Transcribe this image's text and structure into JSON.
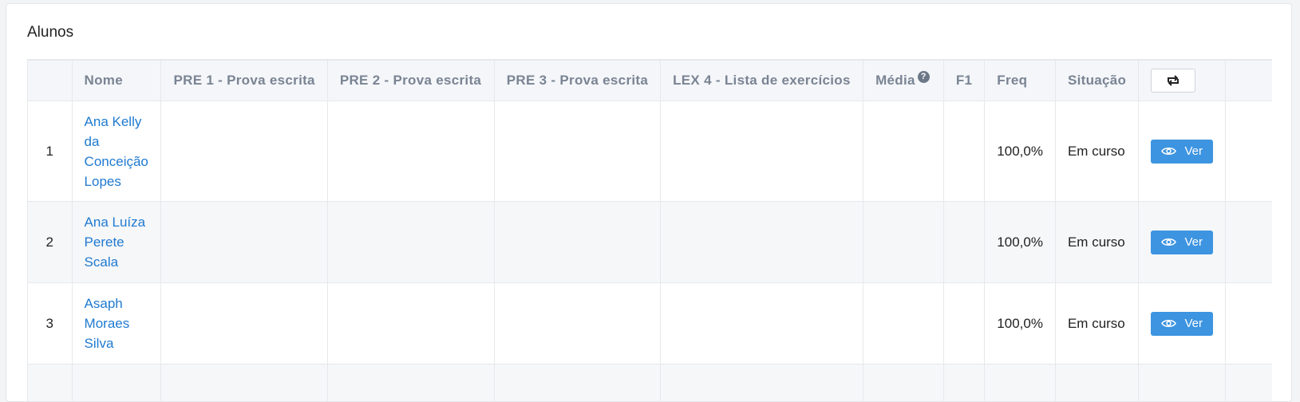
{
  "card": {
    "title": "Alunos"
  },
  "table": {
    "headers": {
      "index": "",
      "nome": "Nome",
      "pre1": "PRE 1 - Prova escrita",
      "pre2": "PRE 2 - Prova escrita",
      "pre3": "PRE 3 - Prova escrita",
      "lex4": "LEX 4 - Lista de exercícios",
      "media": "Média",
      "media_help": "?",
      "f1": "F1",
      "freq": "Freq",
      "situacao": "Situação"
    },
    "refresh_icon": "refresh-icon",
    "view_icon": "eye-icon",
    "rows": [
      {
        "index": "1",
        "name_lines": [
          "Ana Kelly",
          "da",
          "Conceição",
          "Lopes"
        ],
        "freq": "100,0%",
        "situacao": "Em curso",
        "action": "Ver"
      },
      {
        "index": "2",
        "name_lines": [
          "Ana Luíza",
          "Perete",
          "Scala"
        ],
        "freq": "100,0%",
        "situacao": "Em curso",
        "action": "Ver"
      },
      {
        "index": "3",
        "name_lines": [
          "Asaph",
          "Moraes",
          "Silva"
        ],
        "freq": "100,0%",
        "situacao": "Em curso",
        "action": "Ver"
      }
    ]
  },
  "colors": {
    "link": "#1f7ad0",
    "button": "#3d94e0",
    "header_bg": "#f4f6f9"
  }
}
